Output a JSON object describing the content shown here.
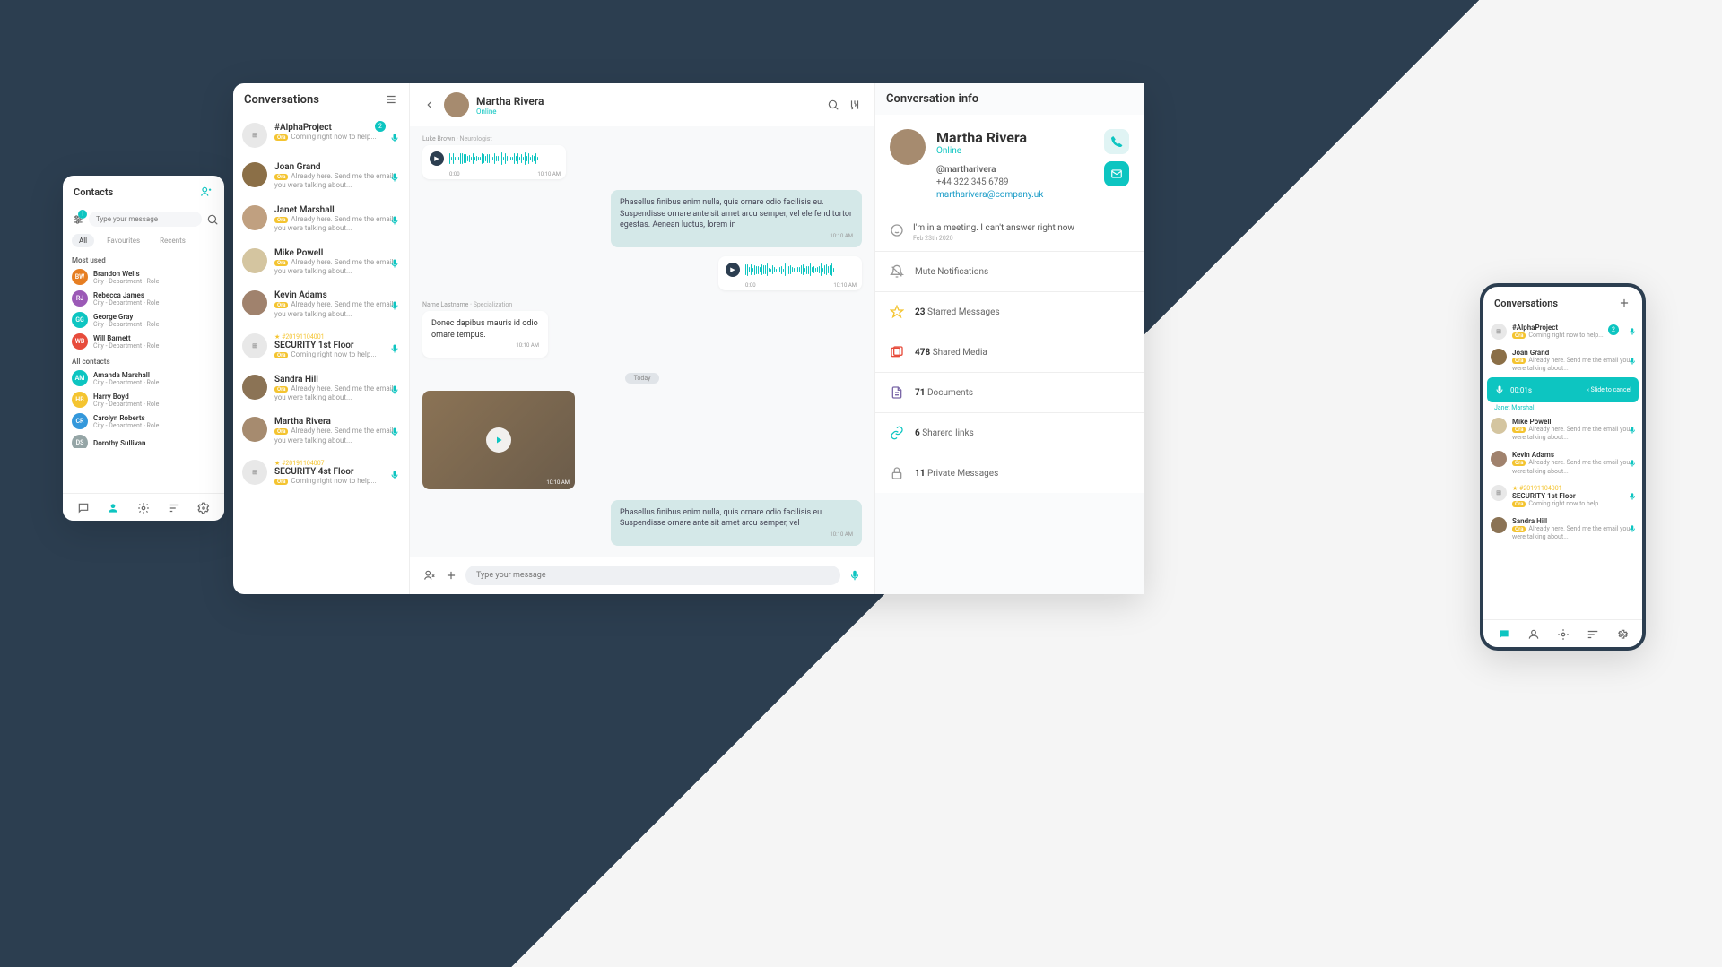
{
  "contacts": {
    "title": "Contacts",
    "search_placeholder": "Type your message",
    "filter_count": "1",
    "tabs": {
      "all": "All",
      "fav": "Favourites",
      "recents": "Recents"
    },
    "section1": "Most used",
    "most_used": [
      {
        "name": "Brandon Wells",
        "meta": "City - Department - Role",
        "init": "BW",
        "color": "#e67e22"
      },
      {
        "name": "Rebecca James",
        "meta": "City - Department - Role",
        "init": "RJ",
        "color": "#9b59b6"
      },
      {
        "name": "George Gray",
        "meta": "City - Department - Role",
        "init": "GG",
        "color": "#0dc5c1"
      },
      {
        "name": "Will Barnett",
        "meta": "City - Department - Role",
        "init": "WB",
        "color": "#e74c3c"
      }
    ],
    "section2": "All contacts",
    "all_contacts": [
      {
        "name": "Amanda Marshall",
        "meta": "City - Department - Role",
        "init": "AM",
        "color": "#0dc5c1"
      },
      {
        "name": "Harry Boyd",
        "meta": "City - Department - Role",
        "init": "HB",
        "color": "#f4c430"
      },
      {
        "name": "Carolyn Roberts",
        "meta": "City - Department - Role",
        "init": "CR",
        "color": "#3498db"
      },
      {
        "name": "Dorothy Sullivan",
        "meta": "",
        "init": "DS",
        "color": "#95a5a6"
      }
    ]
  },
  "main": {
    "sidebar_title": "Conversations",
    "convs": [
      {
        "name": "#AlphaProject",
        "preview": "Coming right now to help...",
        "badge": "2",
        "group": true
      },
      {
        "name": "Joan Grand",
        "preview": "Already here. Send me the email you were talking about...",
        "color": "#8b6f47"
      },
      {
        "name": "Janet Marshall",
        "preview": "Already here. Send me the email you were talking about...",
        "color": "#c0a080"
      },
      {
        "name": "Mike Powell",
        "preview": "Already here. Send me the email you were talking about...",
        "color": "#d4c5a0"
      },
      {
        "name": "Kevin Adams",
        "preview": "Already here. Send me the email you were talking about...",
        "color": "#a0826d"
      },
      {
        "name": "SECURITY 1st Floor",
        "preview": "Coming right now to help...",
        "ticket": "#20191104001",
        "group": true
      },
      {
        "name": "Sandra Hill",
        "preview": "Already here. Send me the email you were talking about...",
        "color": "#8b7355"
      },
      {
        "name": "Martha Rivera",
        "preview": "Already here. Send me the email you were talking about...",
        "color": "#a68b6f"
      },
      {
        "name": "SECURITY 4st Floor",
        "preview": "Coming right now to help...",
        "ticket": "#20191104007",
        "group": true
      }
    ],
    "chat": {
      "name": "Martha Rivera",
      "status": "Online",
      "msg1_author": "Luke Brown",
      "msg1_role": "Neurologist",
      "audio_start": "0:00",
      "audio_end": "10:10 AM",
      "bubble1": "Phasellus finibus enim nulla, quis ornare odio facilisis eu. Suspendisse ornare ante sit amet arcu semper, vel eleifend tortor egestas. Aenean luctus, lorem in",
      "bubble1_time": "10:10 AM",
      "audio2_start": "0:00",
      "audio2_end": "10:10 AM",
      "msg2_author": "Name Lastname",
      "msg2_role": "Specialization",
      "bubble2": "Donec dapibus mauris id odio ornare tempus.",
      "bubble2_time": "10:10 AM",
      "date_sep": "Today",
      "video_time": "10:10 AM",
      "bubble3": "Phasellus finibus enim nulla, quis ornare odio facilisis eu. Suspendisse ornare ante sit amet arcu semper, vel",
      "bubble3_time": "10:10 AM",
      "input_placeholder": "Type your message"
    },
    "info": {
      "title": "Conversation info",
      "name": "Martha Rivera",
      "status": "Online",
      "handle": "@martharivera",
      "phone": "+44 322 345 6789",
      "email": "martharivera@company.uk",
      "status_msg": "I'm in a meeting. I can't answer right now",
      "status_date": "Feb 23th 2020",
      "mute": "Mute Notifications",
      "starred_n": "23",
      "starred": "Starred Messages",
      "media_n": "478",
      "media": "Shared Media",
      "docs_n": "71",
      "docs": "Documents",
      "links_n": "6",
      "links": "Sharerd links",
      "private_n": "11",
      "private": "Private Messages"
    }
  },
  "mobile": {
    "title": "Conversations",
    "convs": [
      {
        "name": "#AlphaProject",
        "preview": "Coming right now to help...",
        "badge": "2",
        "group": true
      },
      {
        "name": "Joan Grand",
        "preview": "Already here. Send me the email you were talking about...",
        "color": "#8b6f47"
      },
      {
        "recording": true,
        "timer": "00:01s",
        "slide": "Slide to cancel",
        "name": "Janet Marshall"
      },
      {
        "name": "Mike Powell",
        "preview": "Already here. Send me the email you were talking about...",
        "color": "#d4c5a0"
      },
      {
        "name": "Kevin Adams",
        "preview": "Already here. Send me the email you were talking about...",
        "color": "#a0826d"
      },
      {
        "name": "SECURITY 1st Floor",
        "preview": "Coming right now to help...",
        "ticket": "#20191104001",
        "group": true
      },
      {
        "name": "Sandra Hill",
        "preview": "Already here. Send me the email you were talking about...",
        "color": "#8b7355"
      }
    ]
  }
}
